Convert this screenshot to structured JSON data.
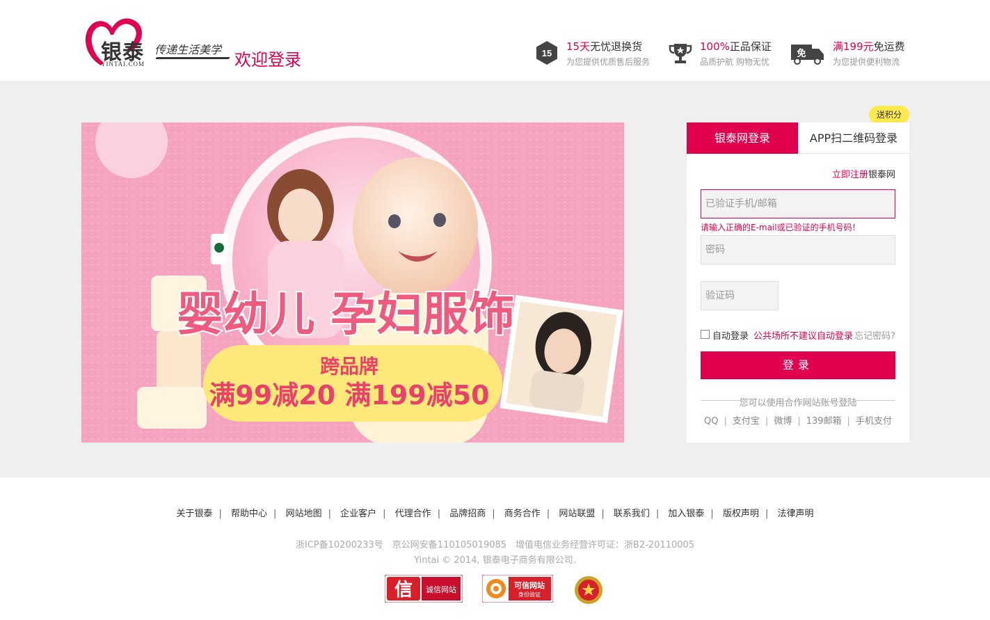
{
  "header": {
    "logo_text": "银泰",
    "logo_sub": "YINTAI.COM",
    "slogan": "传递生活美学",
    "welcome": "欢迎登录",
    "promises": [
      {
        "icon": "return-15-icon",
        "title_hl": "15天",
        "title_rest": "无忧退换货",
        "sub": "为您提供优质售后服务"
      },
      {
        "icon": "trophy-icon",
        "title_hl": "100%",
        "title_rest": "正品保证",
        "sub": "品质护航 购物无忧"
      },
      {
        "icon": "truck-free-icon",
        "title_hl": "满199元",
        "title_rest": "免运费",
        "sub": "为您提供便利物流"
      }
    ],
    "icon_text_15": "15",
    "icon_text_free": "免"
  },
  "banner": {
    "headline": "婴幼儿 孕妇服饰",
    "pill_title": "跨品牌",
    "pill_offer": "满99减20 满199减50"
  },
  "login": {
    "bubble": "送积分",
    "tab_active": "银泰网登录",
    "tab_inactive": "APP扫二维码登录",
    "register_link": "立即注册",
    "register_rest": "银泰网",
    "account_placeholder": "已验证手机/邮箱",
    "error_msg": "请输入正确的E-mail或已验证的手机号码！",
    "password_placeholder": "密码",
    "captcha_placeholder": "验证码",
    "auto_login": "自动登录",
    "public_warn": "公共场所不建议自动登录",
    "forgot": "忘记密码?",
    "login_btn": "登录",
    "partner_head": "您可以使用合作网站账号登陆",
    "partners": [
      "QQ",
      "支付宝",
      "微博",
      "139邮箱",
      "手机支付"
    ]
  },
  "footer": {
    "links": [
      "关于银泰",
      "帮助中心",
      "网站地图",
      "企业客户",
      "代理合作",
      "品牌招商",
      "商务合作",
      "网站联盟",
      "联系我们",
      "加入银泰",
      "版权声明",
      "法律声明"
    ],
    "icp": "浙ICP备10200233号　京公网安备110105019085　增值电信业务经营许可证：浙B2-20110005",
    "copyright": "Yintai © 2014, 银泰电子商务有限公司.",
    "badge1": "诚信网站",
    "badge1_glyph": "信",
    "badge2_title": "可信网站",
    "badge2_sub": "身份验证"
  }
}
